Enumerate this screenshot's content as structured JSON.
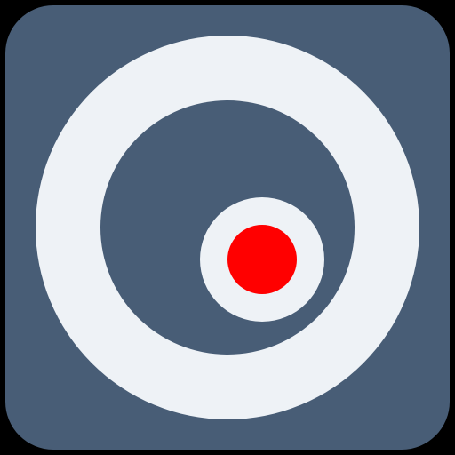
{
  "icon": {
    "name": "camera-record-icon",
    "colors": {
      "background": "#000000",
      "tile": "#485d76",
      "ring": "#eef2f6",
      "inner": "#485d76",
      "lens_ring": "#eef2f6",
      "record_dot": "#ff0000"
    }
  }
}
